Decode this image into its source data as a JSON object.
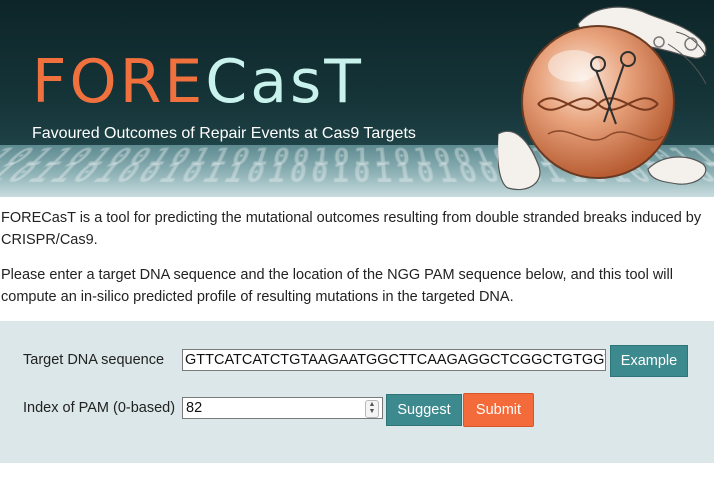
{
  "banner": {
    "title_part1": "FORE",
    "title_part2": "CasT",
    "subtitle": "Favoured Outcomes of Repair Events at Cas9 Targets",
    "colors": {
      "accent_orange": "#f0703e",
      "accent_cyan": "#c9f2ec",
      "background": "#16363a"
    }
  },
  "intro": {
    "paragraph1": "FORECasT is a tool for predicting the mutational outcomes resulting from double stranded breaks induced by CRISPR/Cas9.",
    "paragraph2": "Please enter a target DNA sequence and the location of the NGG PAM sequence below, and this tool will compute an in-silico predicted profile of resulting mutations in the targeted DNA."
  },
  "form": {
    "sequence_label": "Target DNA sequence",
    "sequence_value": "GTTCATCATCTGTAAGAATGGCTTCAAGAGGCTCGGCTGTGGTT",
    "example_label": "Example",
    "pam_label": "Index of PAM (0-based)",
    "pam_value": "82",
    "suggest_label": "Suggest",
    "submit_label": "Submit",
    "colors": {
      "panel": "#dbe7e8",
      "teal_button": "#3d8a8e",
      "submit_button": "#f36a3b"
    }
  }
}
